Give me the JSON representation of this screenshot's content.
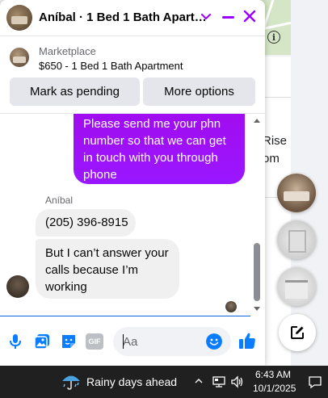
{
  "chat": {
    "title": "Aníbal · 1 Bed 1 Bath Apart…",
    "marketplace_label": "Marketplace",
    "listing_title": "$650 - 1 Bed 1 Bath Apartment",
    "mark_pending_label": "Mark as pending",
    "more_options_label": "More options"
  },
  "messages": {
    "outgoing": "Please send me your phn number so that we can get in touch with you through phone",
    "sender_name": "Aníbal",
    "incoming": [
      "(205) 396-8915",
      "But I can’t answer your calls because I’m working"
    ]
  },
  "composer": {
    "placeholder": "Aa",
    "gif_label": "GIF"
  },
  "background": {
    "text_line1": "Rise",
    "text_line2": "om"
  },
  "taskbar": {
    "weather": "Rainy days ahead",
    "time": "6:43 AM",
    "date": "10/1/2025"
  },
  "colors": {
    "accent": "#9b00ff",
    "messenger_blue": "#0a7cff",
    "bubble_gray": "#f0f0f0",
    "taskbar": "#202020"
  },
  "icons": [
    "chevron-down-icon",
    "minimize-icon",
    "close-icon",
    "microphone-icon",
    "photo-icon",
    "sticker-icon",
    "gif-icon",
    "emoji-icon",
    "like-icon",
    "compose-icon",
    "weather-icon",
    "network-icon",
    "volume-icon",
    "notification-icon",
    "info-icon"
  ]
}
